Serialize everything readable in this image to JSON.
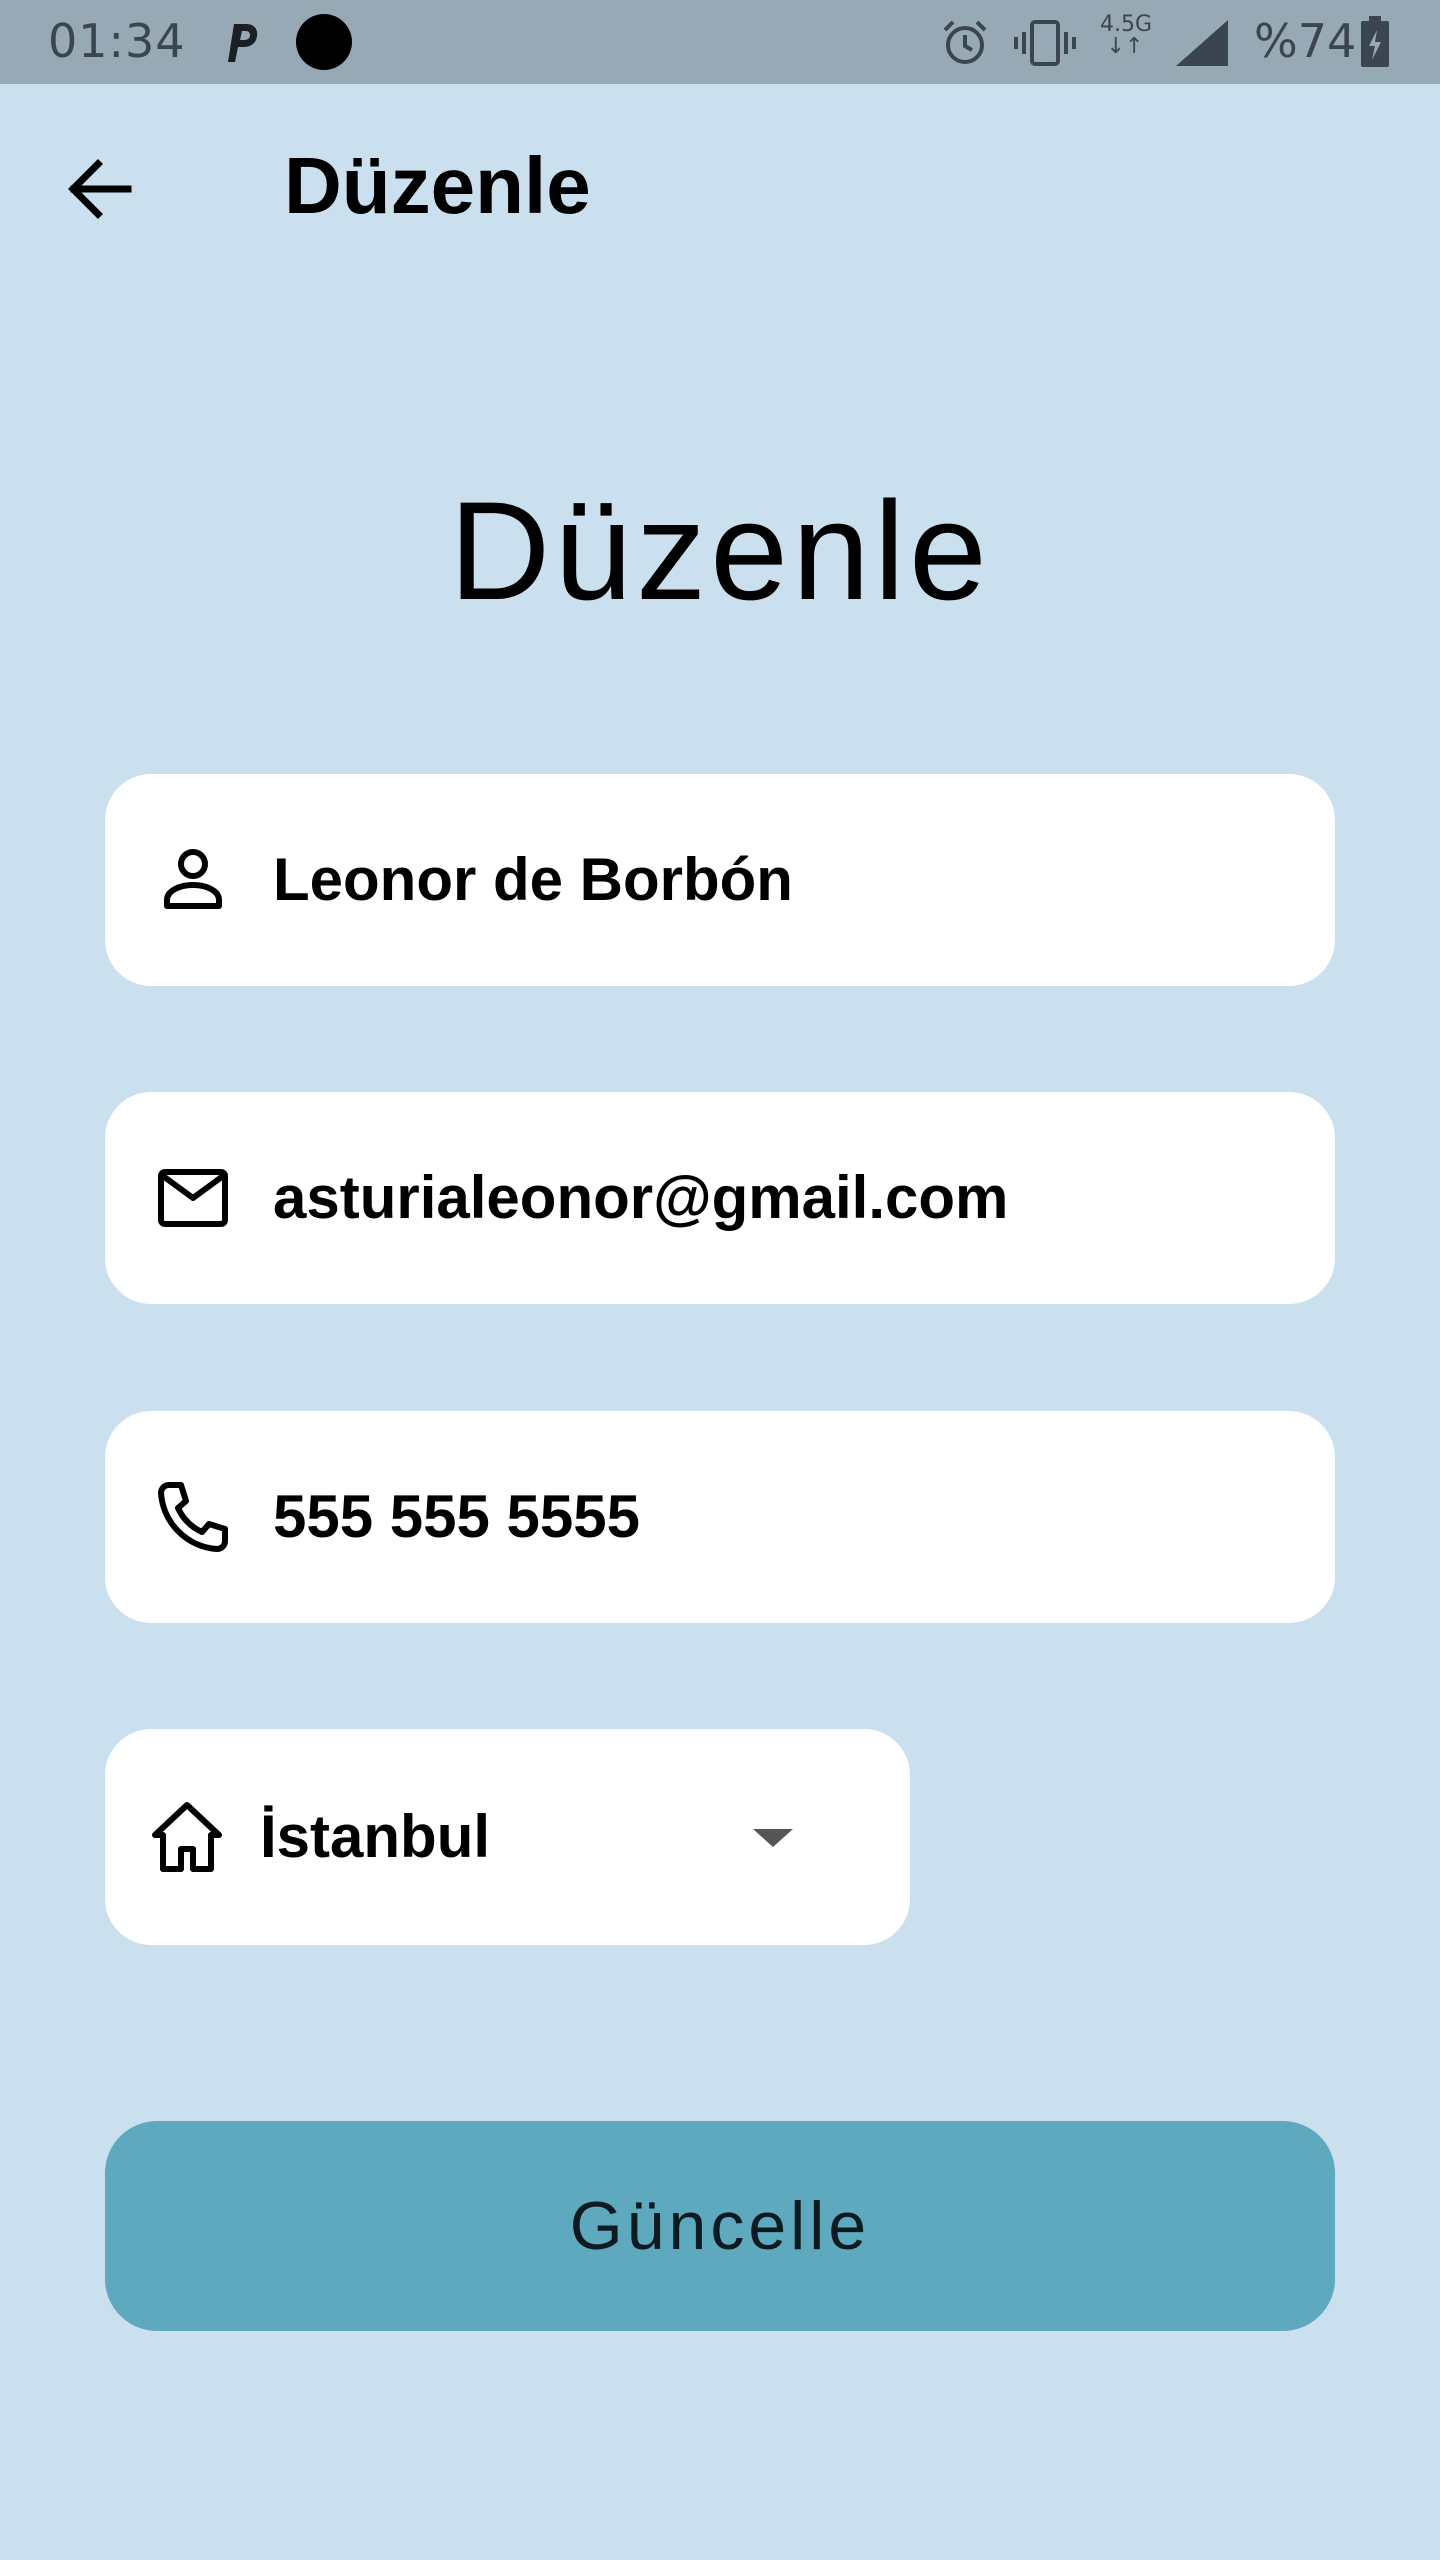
{
  "status_bar": {
    "time": "01:34",
    "network_type": "4.5G",
    "network_arrows": "↓↑",
    "battery_text": "%74",
    "icons": [
      "parking-app-icon",
      "notification-dot-icon",
      "alarm-icon",
      "vibrate-icon",
      "signal-icon",
      "battery-charging-icon"
    ]
  },
  "app_bar": {
    "title": "Düzenle",
    "back_icon": "arrow-back-icon"
  },
  "page": {
    "heading": "Düzenle"
  },
  "form": {
    "name": {
      "icon": "person-icon",
      "value": "Leonor de Borbón"
    },
    "email": {
      "icon": "mail-icon",
      "value": "asturialeonor@gmail.com"
    },
    "phone": {
      "icon": "phone-icon",
      "value": "555 555 5555"
    },
    "city": {
      "icon": "home-icon",
      "selected": "İstanbul",
      "caret_icon": "dropdown-caret-icon"
    }
  },
  "actions": {
    "update_label": "Güncelle"
  },
  "colors": {
    "background": "#cbe0ee",
    "status_bar": "#98a9b6",
    "field": "#ffffff",
    "button": "#5ea9bd"
  }
}
